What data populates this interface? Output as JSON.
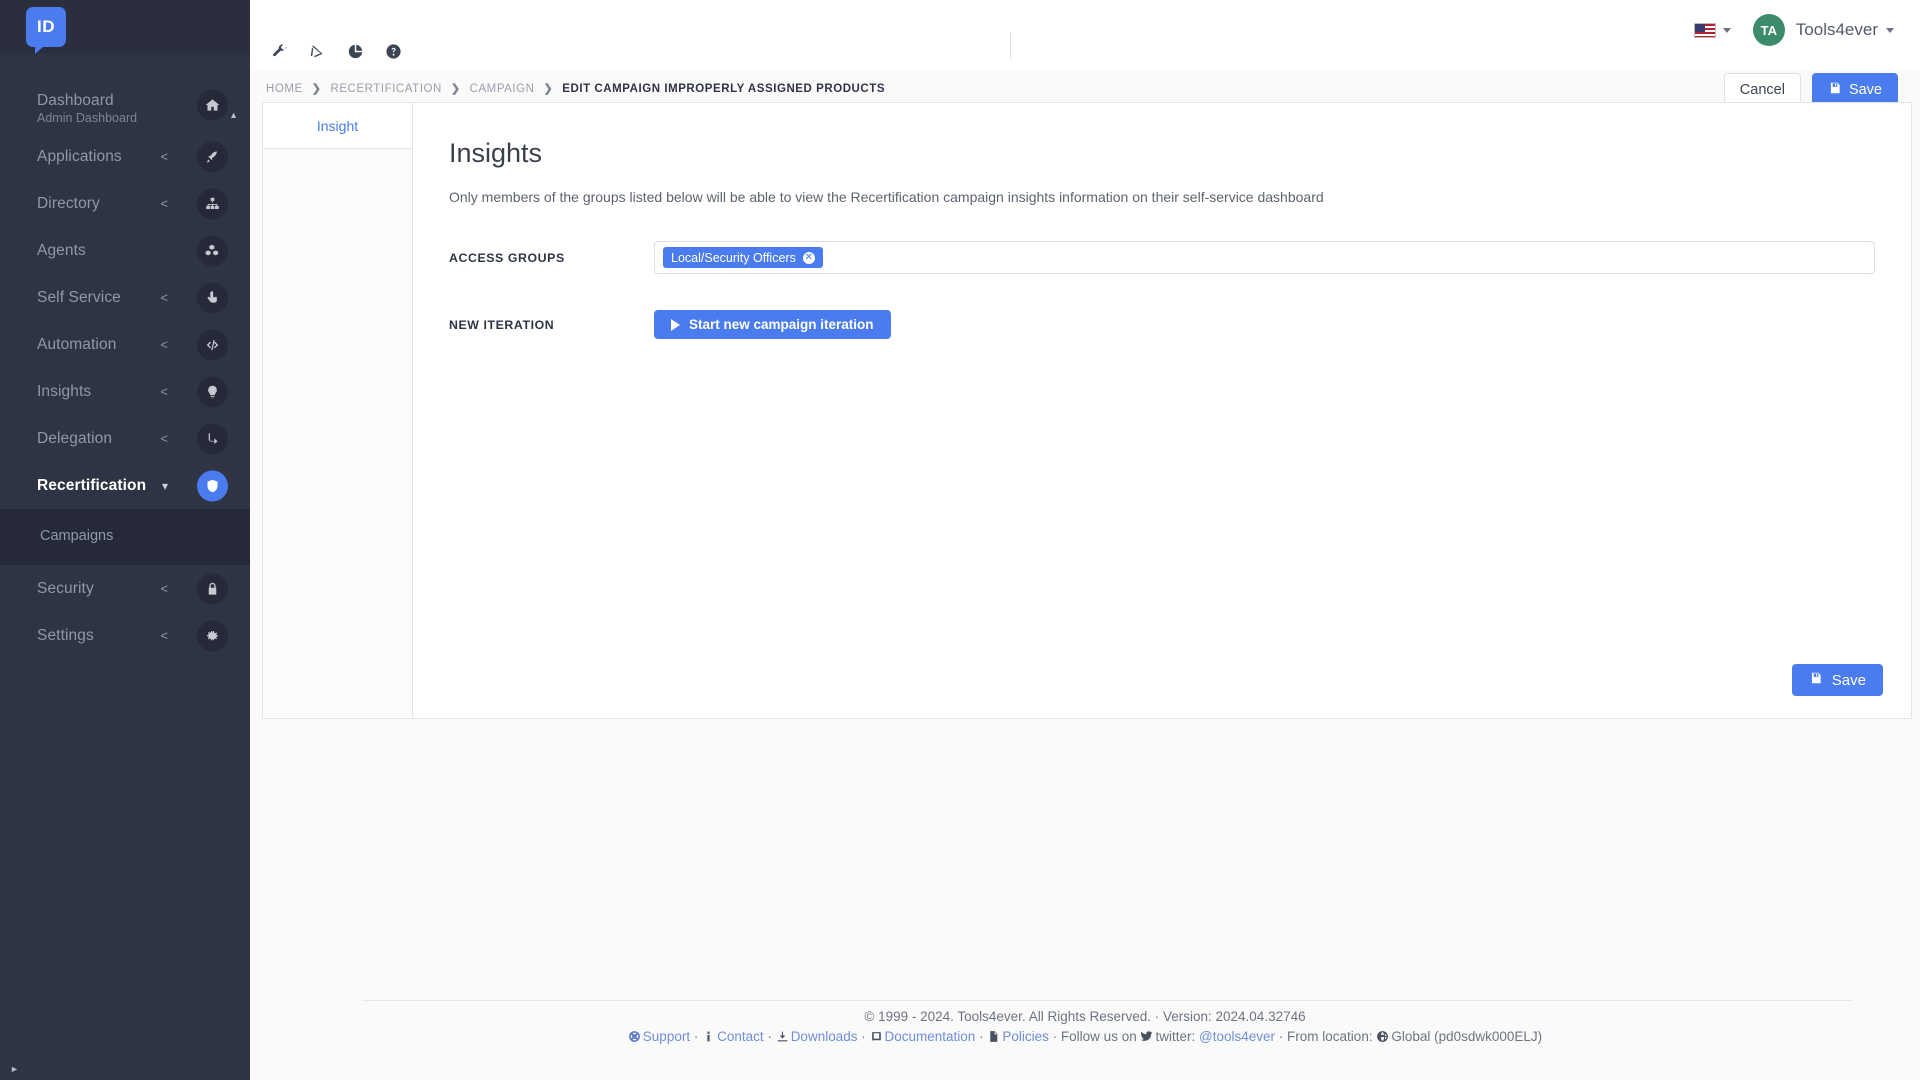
{
  "sidebar": {
    "logo_text": "ID",
    "items": [
      {
        "label": "Dashboard",
        "sublabel": "Admin Dashboard",
        "icon": "home-icon",
        "arrow": "",
        "active": false
      },
      {
        "label": "Applications",
        "sublabel": "",
        "icon": "rocket-icon",
        "arrow": "<",
        "active": false
      },
      {
        "label": "Directory",
        "sublabel": "",
        "icon": "sitemap-icon",
        "arrow": "<",
        "active": false
      },
      {
        "label": "Agents",
        "sublabel": "",
        "icon": "cubes-icon",
        "arrow": "",
        "active": false
      },
      {
        "label": "Self Service",
        "sublabel": "",
        "icon": "hand-pointer-icon",
        "arrow": "<",
        "active": false
      },
      {
        "label": "Automation",
        "sublabel": "",
        "icon": "code-icon",
        "arrow": "<",
        "active": false
      },
      {
        "label": "Insights",
        "sublabel": "",
        "icon": "lightbulb-icon",
        "arrow": "<",
        "active": false
      },
      {
        "label": "Delegation",
        "sublabel": "",
        "icon": "share-arrow-icon",
        "arrow": "<",
        "active": false
      },
      {
        "label": "Recertification",
        "sublabel": "",
        "icon": "shield-icon",
        "arrow": "v",
        "active": true
      }
    ],
    "subitems": [
      {
        "label": "Campaigns"
      }
    ],
    "items_after": [
      {
        "label": "Security",
        "sublabel": "",
        "icon": "lock-icon",
        "arrow": "<",
        "active": false
      },
      {
        "label": "Settings",
        "sublabel": "",
        "icon": "gear-icon",
        "arrow": "<",
        "active": false
      }
    ]
  },
  "topbar": {
    "icons": [
      "wrench-icon",
      "triangle-ruler-icon",
      "pie-chart-icon",
      "question-circle-icon"
    ],
    "language": "en-US",
    "avatar_initials": "TA",
    "user_name": "Tools4ever"
  },
  "breadcrumb": {
    "items": [
      {
        "label": "HOME"
      },
      {
        "label": "RECERTIFICATION"
      },
      {
        "label": "CAMPAIGN"
      },
      {
        "label": "EDIT CAMPAIGN IMPROPERLY ASSIGNED PRODUCTS"
      }
    ],
    "separator": "❯",
    "cancel_label": "Cancel",
    "save_label": "Save"
  },
  "panel": {
    "tabs": [
      {
        "label": "Insight",
        "active": true
      }
    ],
    "title": "Insights",
    "description": "Only members of the groups listed below will be able to view the Recertification campaign insights information on their self-service dashboard",
    "access_groups": {
      "label": "ACCESS GROUPS",
      "tags": [
        {
          "text": "Local/Security Officers",
          "remove": "✕"
        }
      ]
    },
    "new_iteration": {
      "label": "NEW ITERATION",
      "button_label": "Start new campaign iteration"
    },
    "save_label": "Save"
  },
  "footer": {
    "copyright": "© 1999 - 2024. Tools4ever. All Rights Reserved. · Version: 2024.04.32746",
    "links": {
      "support": "Support",
      "contact": "Contact",
      "downloads": "Downloads",
      "documentation": "Documentation",
      "policies": "Policies",
      "follow_text": "Follow us on",
      "twitter_text": "twitter:",
      "twitter_handle": "@tools4ever",
      "location_text": "From location:",
      "location_value": "Global (pd0sdwk000ELJ)",
      "sep": "·"
    }
  },
  "colors": {
    "accent": "#4a7cf0",
    "sidebar_bg": "#2f3445",
    "sidebar_sub_bg": "#262a38",
    "avatar_bg": "#3d8b6d"
  }
}
